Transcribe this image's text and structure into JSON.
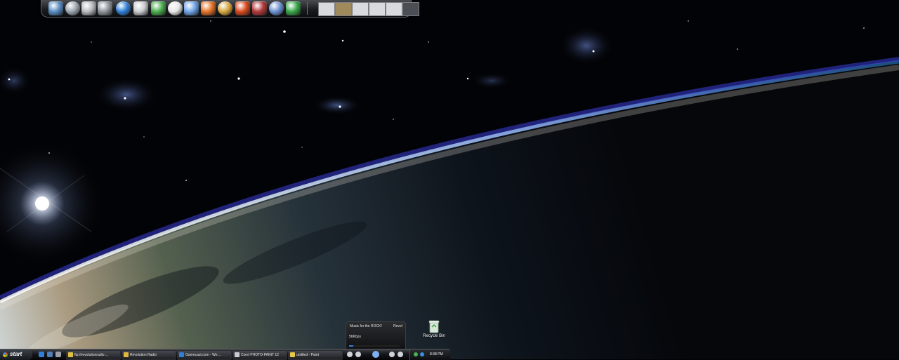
{
  "dock": {
    "icons": [
      {
        "name": "my-computer-icon",
        "color": "#5a8ec4"
      },
      {
        "name": "documents-icon",
        "color": "#9ba3ad"
      },
      {
        "name": "file-cabinet-icon",
        "color": "#b7bcc2"
      },
      {
        "name": "printer-icon",
        "color": "#8f959c"
      },
      {
        "name": "internet-explorer-icon",
        "color": "#2f7fd6"
      },
      {
        "name": "skull-app-icon",
        "color": "#c9ccd0"
      },
      {
        "name": "messenger-icon",
        "color": "#4caf50"
      },
      {
        "name": "mustache-app-icon",
        "color": "#e6e6e6"
      },
      {
        "name": "pidgin-messenger-icon",
        "color": "#6fa6e8"
      },
      {
        "name": "firefox-icon",
        "color": "#e8742a"
      },
      {
        "name": "winrar-icon",
        "color": "#d6a640"
      },
      {
        "name": "burning-app-icon",
        "color": "#d94a1f"
      },
      {
        "name": "movie-maker-icon",
        "color": "#b23a3a"
      },
      {
        "name": "itunes-icon",
        "color": "#6a8fd0"
      },
      {
        "name": "xbox-live-icon",
        "color": "#3aa84a"
      }
    ],
    "thumbnails": [
      "window-thumb-1",
      "window-thumb-2",
      "window-thumb-3",
      "window-thumb-4",
      "window-thumb-5",
      "window-thumb-6"
    ]
  },
  "desktop": {
    "recycle_bin_label": "Recycle Bin"
  },
  "radio_player": {
    "track": "Music for the ROCK!",
    "station": "Revol",
    "bitrate": "56Kbps",
    "progress": 0.08
  },
  "taskbar": {
    "start_label": "start",
    "quick_launch": [
      {
        "name": "ie-quicklaunch-icon",
        "color": "#2f7fd6"
      },
      {
        "name": "desktop-quicklaunch-icon",
        "color": "#4e7fb8"
      },
      {
        "name": "media-quicklaunch-icon",
        "color": "#9aa0a8"
      }
    ],
    "tasks": [
      {
        "name": "task-ftp",
        "label": "ftp://revolutionradio ...",
        "icon_color": "#e0c040"
      },
      {
        "name": "task-revolution-radio",
        "label": "Revolution Radio",
        "icon_color": "#e0b840"
      },
      {
        "name": "task-gamecast",
        "label": "Gamecast.com - We ...",
        "icon_color": "#2f7fd6"
      },
      {
        "name": "task-corel-photo-paint",
        "label": "Corel PHOTO-PAINT 12",
        "icon_color": "#c8cbd0"
      },
      {
        "name": "task-paint",
        "label": "untitled - Paint",
        "icon_color": "#e8c64a"
      }
    ],
    "clock": "8:38 PM"
  }
}
